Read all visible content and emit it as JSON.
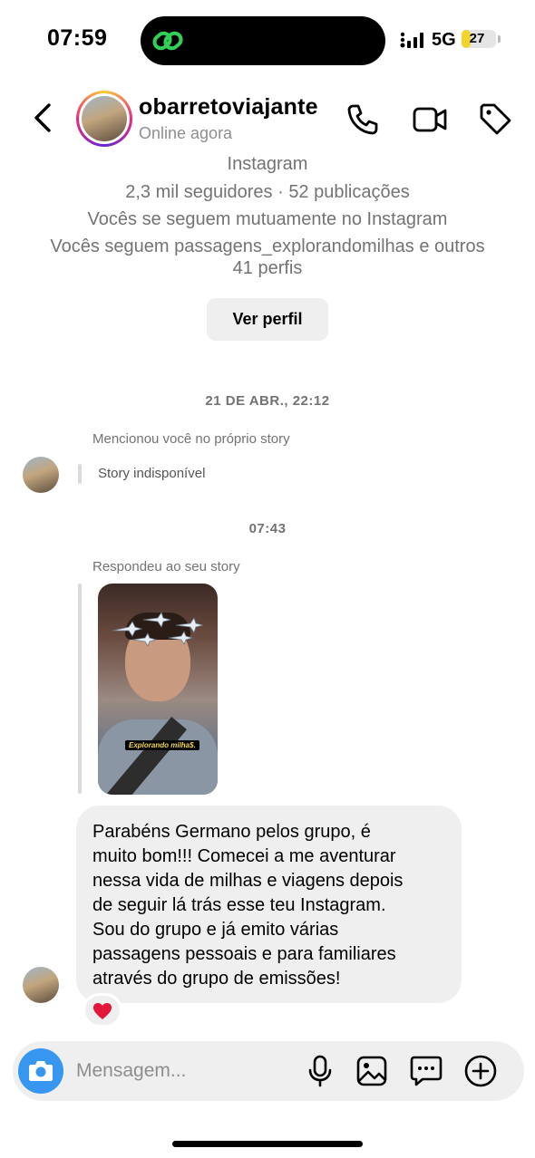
{
  "status_bar": {
    "time": "07:59",
    "network": "5G",
    "battery": "27",
    "battery_level": 0.27
  },
  "header": {
    "username": "obarretoviajante",
    "status": "Online agora"
  },
  "profile_summary": {
    "platform": "Instagram",
    "stats": "2,3 mil seguidores · 52 publicações",
    "mutual": "Vocês se seguem mutuamente no Instagram",
    "followed_by_line1": "Vocês seguem passagens_explorandomilhas e outros",
    "followed_by_line2": "41 perfis",
    "view_profile_label": "Ver perfil"
  },
  "messages": {
    "timestamp_1": "21 DE ABR., 22:12",
    "mention_label": "Mencionou você no próprio story",
    "story_unavailable": "Story indisponível",
    "timestamp_2": "07:43",
    "reply_label": "Respondeu ao seu story",
    "story_caption": "Explorando milha$.",
    "bubble_lines": [
      "Parabéns Germano pelos grupo, é",
      "muito bom!!! Comecei a me aventurar",
      "nessa vida de milhas e viagens depois",
      "de seguir lá trás esse teu Instagram.",
      "Sou do grupo e já emito várias",
      "passagens pessoais e para familiares",
      "através do grupo de emissões!"
    ],
    "reaction": "❤️"
  },
  "composer": {
    "placeholder": "Mensagem..."
  },
  "icons": {
    "back": "chevron-left-icon",
    "call": "phone-icon",
    "video": "video-camera-icon",
    "tag": "tag-icon",
    "camera": "camera-icon",
    "mic": "microphone-icon",
    "gallery": "image-icon",
    "sticker": "chat-bubble-icon",
    "plus": "plus-circle-icon"
  },
  "colors": {
    "accent_blue": "#3797f0",
    "bubble_gray": "#efefef",
    "secondary_text": "#737373",
    "battery_yellow": "#f4d32a"
  }
}
